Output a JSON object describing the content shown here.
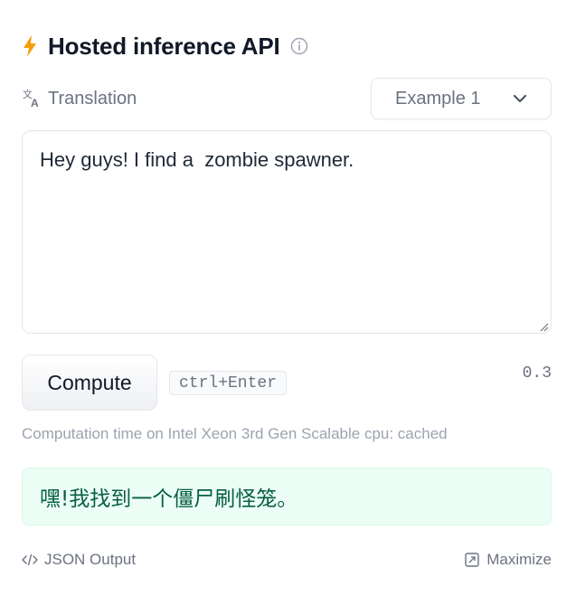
{
  "header": {
    "title": "Hosted inference API",
    "bolt_icon": "lightning-bolt-icon",
    "info_icon": "info-icon"
  },
  "task": {
    "label": "Translation",
    "icon": "translate-icon"
  },
  "example_select": {
    "selected": "Example 1",
    "icon": "chevron-down-icon"
  },
  "input": {
    "value": "Hey guys! I find a  zombie spawner."
  },
  "compute": {
    "button_label": "Compute",
    "shortcut": "ctrl+Enter",
    "timing": "0.3"
  },
  "computation_time": "Computation time on Intel Xeon 3rd Gen Scalable cpu: cached",
  "output": {
    "text": "嘿!我找到一个僵尸刷怪笼。"
  },
  "footer": {
    "json_output_label": "JSON Output",
    "maximize_label": "Maximize"
  },
  "colors": {
    "accent_bolt": "#f59e0b",
    "output_bg": "#ecfdf5",
    "output_text": "#065f46"
  }
}
